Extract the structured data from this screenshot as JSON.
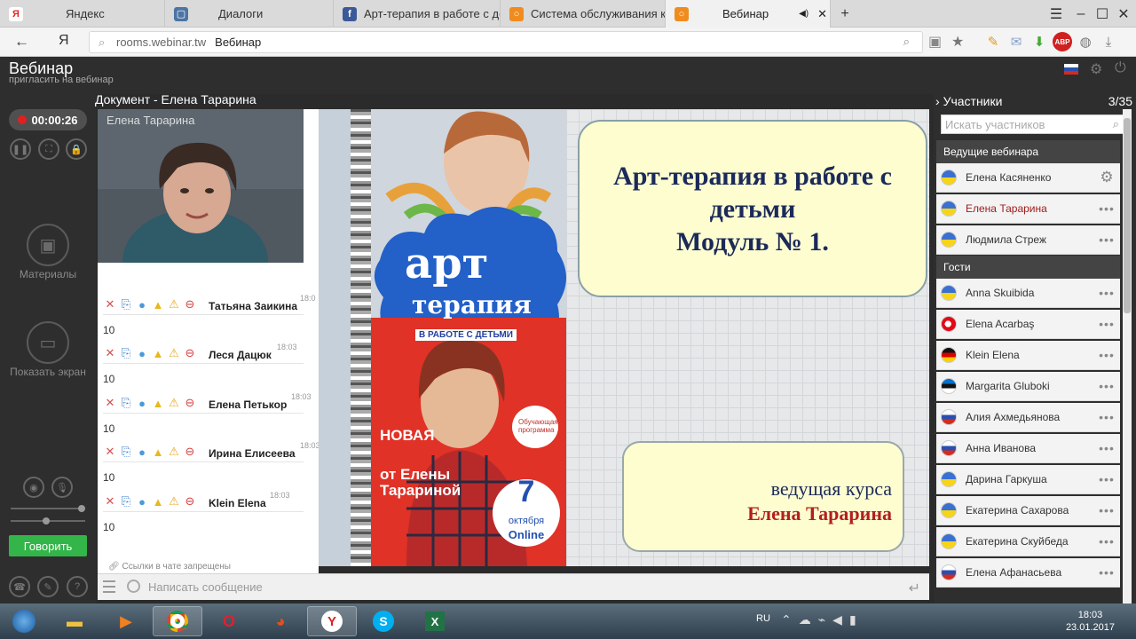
{
  "browser": {
    "tabs": [
      {
        "label": "Яндекс",
        "icon": "yandex-icon",
        "color": "#e52620"
      },
      {
        "label": "Диалоги",
        "icon": "dialog-icon",
        "color": "#4c74a4"
      },
      {
        "label": "Арт-терапия в работе с дет",
        "icon": "facebook-icon",
        "color": "#3b5998"
      },
      {
        "label": "Система обслуживания кли",
        "icon": "webinar-icon",
        "color": "#f08c1e"
      },
      {
        "label": "Вебинар",
        "icon": "webinar-icon",
        "color": "#f08c1e"
      }
    ],
    "new_tab": "+",
    "address": {
      "domain": "rooms.webinar.tw",
      "title": "Вебинар"
    }
  },
  "app": {
    "title": "Вебинар",
    "subtitle": "пригласить на вебинар",
    "document_title": "Документ - Елена Тарарина"
  },
  "left": {
    "timer": "00:00:26",
    "materials_label": "Материалы",
    "screen_label": "Показать экран",
    "speak_label": "Говорить"
  },
  "video": {
    "label": "Елена Тарарина"
  },
  "chat": {
    "messages": [
      {
        "author": "Татьяна Заикина",
        "time": "18:0",
        "text": "10"
      },
      {
        "author": "Леся Дацюк",
        "time": "18:03",
        "text": "10"
      },
      {
        "author": "Елена Петькор",
        "time": "18:03",
        "text": "10"
      },
      {
        "author": "Ирина Елисеева",
        "time": "18:03",
        "text": "10"
      },
      {
        "author": "Klein Elena",
        "time": "18:03",
        "text": "10"
      }
    ],
    "links_note": "Ссылки в чате запрещены",
    "placeholder": "Написать сообщение"
  },
  "slide": {
    "title_line1": "Арт-терапия в работе с",
    "title_line2": "детьми",
    "title_line3": "Модуль № 1.",
    "host_line1": "ведущая курса",
    "host_line2": "Елена Тарарина",
    "poster": {
      "logo1": "арт",
      "logo2": "терапия",
      "logo3": "В РАБОТЕ С ДЕТЬМИ",
      "new": "НОВАЯ",
      "from1": "от Елены",
      "from2": "Тарариной",
      "badge": "Обучающая программа",
      "day": "7",
      "month": "октября",
      "online": "Online"
    }
  },
  "participants": {
    "title": "Участники",
    "count": "3/35",
    "search_placeholder": "Искать участников",
    "hosts_label": "Ведущие вебинара",
    "guests_label": "Гости",
    "hosts": [
      {
        "name": "Елена Касяненко",
        "flag": "ua",
        "action": "gear"
      },
      {
        "name": "Елена Тарарина",
        "flag": "ua",
        "action": "dots"
      },
      {
        "name": "Людмила Стреж",
        "flag": "ua",
        "action": "dots"
      }
    ],
    "guests": [
      {
        "name": "Anna Skuibida",
        "flag": "ua"
      },
      {
        "name": "Elena Acarbaş",
        "flag": "tr"
      },
      {
        "name": "Klein Elena",
        "flag": "de"
      },
      {
        "name": "Margarita Gluboki",
        "flag": "ee"
      },
      {
        "name": "Алия Ахмедьянова",
        "flag": "ru"
      },
      {
        "name": "Анна Иванова",
        "flag": "ru"
      },
      {
        "name": "Дарина Гаркуша",
        "flag": "ua"
      },
      {
        "name": "Екатерина Сахарова",
        "flag": "ua"
      },
      {
        "name": "Екатерина Скуйбеда",
        "flag": "ua"
      },
      {
        "name": "Елена Афанасьева",
        "flag": "ru"
      }
    ]
  },
  "taskbar": {
    "lang": "RU",
    "time": "18:03",
    "date": "23.01.2017"
  }
}
